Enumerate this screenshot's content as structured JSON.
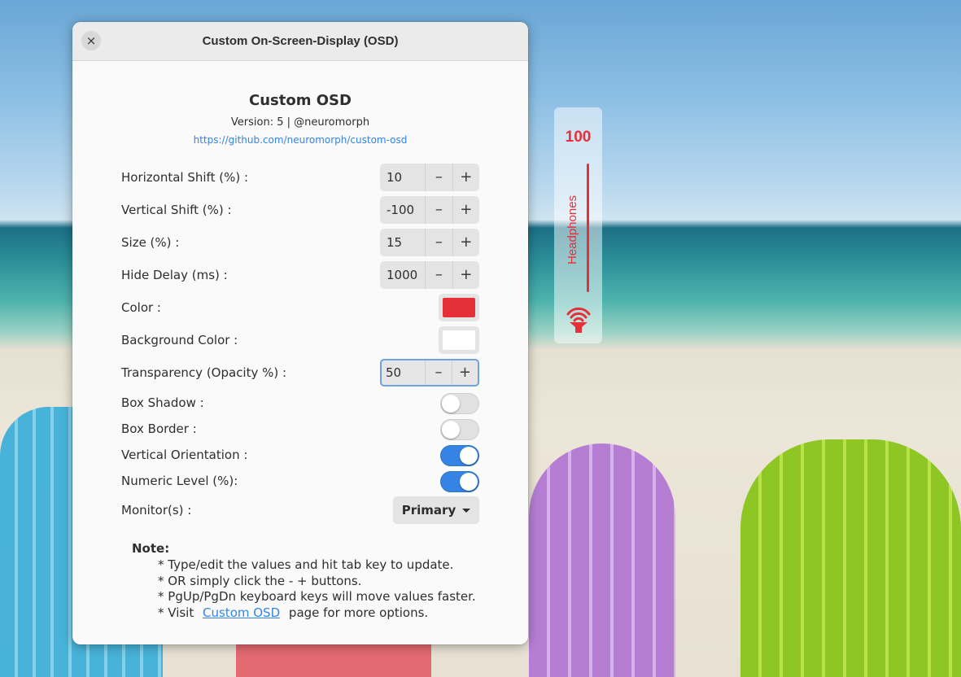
{
  "window": {
    "title": "Custom On-Screen-Display (OSD)",
    "close_icon": "×"
  },
  "header": {
    "app_name": "Custom OSD",
    "version": "Version: 5  |  @neuromorph",
    "url": "https://github.com/neuromorph/custom-osd"
  },
  "settings": {
    "horizontal_shift": {
      "label": "Horizontal Shift (%) :",
      "value": "10"
    },
    "vertical_shift": {
      "label": "Vertical Shift (%) :",
      "value": "-100"
    },
    "size": {
      "label": "Size (%) :",
      "value": "15"
    },
    "hide_delay": {
      "label": "Hide Delay (ms) :",
      "value": "1000"
    },
    "color": {
      "label": "Color :",
      "value": "#e63039"
    },
    "background_color": {
      "label": "Background Color :",
      "value": "#ffffff"
    },
    "transparency": {
      "label": "Transparency (Opacity %) :",
      "value": "50"
    },
    "box_shadow": {
      "label": "Box Shadow :",
      "on": false
    },
    "box_border": {
      "label": "Box Border :",
      "on": false
    },
    "vertical_orientation": {
      "label": "Vertical Orientation :",
      "on": true
    },
    "numeric_level": {
      "label": "Numeric Level (%):",
      "on": true
    },
    "monitors": {
      "label": "Monitor(s) :",
      "value": "Primary"
    }
  },
  "spin_buttons": {
    "minus": "–",
    "plus": "+"
  },
  "note": {
    "title": "Note:",
    "line1": "* Type/edit the values and hit tab key to update.",
    "line2": "* OR simply click the - + buttons.",
    "line3": "* PgUp/PgDn keyboard keys will move values faster.",
    "line4_prefix": "* Visit",
    "line4_link": "Custom OSD",
    "line4_suffix": "page for more options."
  },
  "osd": {
    "level": "100",
    "device": "Headphones",
    "icon": "headphones-volume-icon",
    "accent_color": "#e63039"
  }
}
